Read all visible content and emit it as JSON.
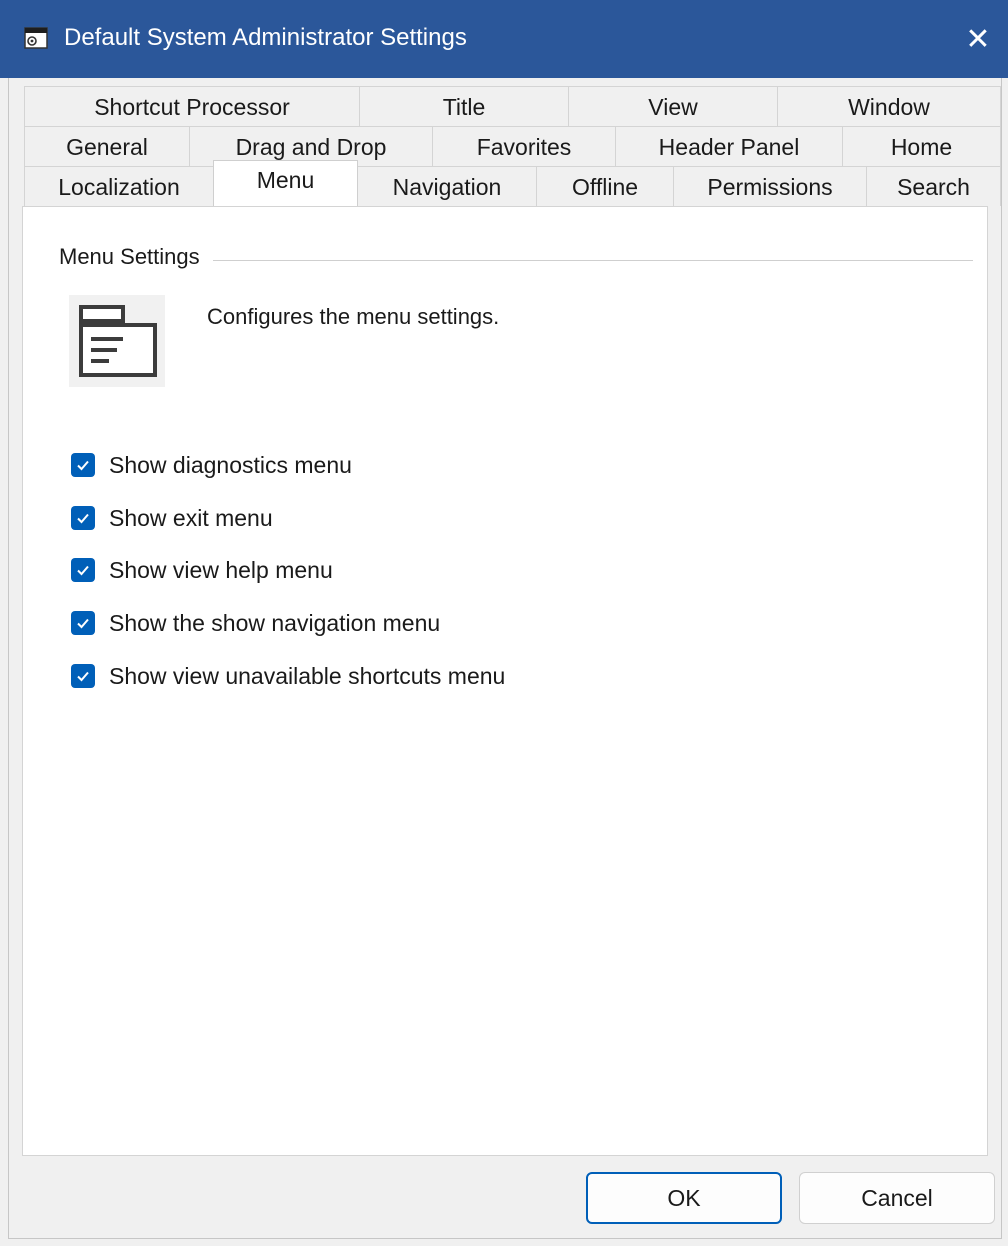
{
  "window": {
    "title": "Default System Administrator Settings",
    "close_icon": "close-icon",
    "app_icon": "settings-window-icon"
  },
  "tabs": {
    "row1": [
      "Shortcut Processor",
      "Title",
      "View",
      "Window"
    ],
    "row2": [
      "General",
      "Drag and Drop",
      "Favorites",
      "Header Panel",
      "Home"
    ],
    "row3": [
      "Localization",
      "Menu",
      "Navigation",
      "Offline",
      "Permissions",
      "Search"
    ],
    "active": "Menu"
  },
  "group": {
    "title": "Menu Settings",
    "description": "Configures the menu settings.",
    "icon": "menu-settings-icon"
  },
  "checkboxes": [
    {
      "label": "Show diagnostics menu",
      "checked": true
    },
    {
      "label": "Show exit menu",
      "checked": true
    },
    {
      "label": "Show view help menu",
      "checked": true
    },
    {
      "label": "Show the show navigation menu",
      "checked": true
    },
    {
      "label": "Show view unavailable shortcuts menu",
      "checked": true
    }
  ],
  "buttons": {
    "ok": "OK",
    "cancel": "Cancel"
  },
  "colors": {
    "titlebar": "#2b579a",
    "checkbox_accent": "#005fb8"
  }
}
